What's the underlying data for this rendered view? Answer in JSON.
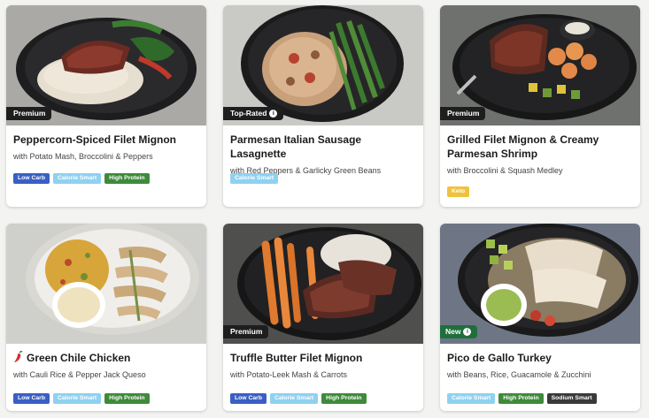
{
  "meals": [
    {
      "badge": "Premium",
      "badge_style": "dark",
      "badge_info": false,
      "title": "Peppercorn-Spiced Filet Mignon",
      "subtitle": "with Potato Mash, Broccolini & Peppers",
      "spicy": false,
      "tags": [
        {
          "label": "Low Carb",
          "color": "#3a5fc4"
        },
        {
          "label": "Calorie Smart",
          "color": "#8fd1f0"
        },
        {
          "label": "High Protein",
          "color": "#3f8a3a"
        }
      ]
    },
    {
      "badge": "Top-Rated",
      "badge_style": "dark",
      "badge_info": true,
      "title": "Parmesan Italian Sausage Lasagnette",
      "subtitle": "with Red Peppers & Garlicky Green Beans",
      "spicy": false,
      "tags": [
        {
          "label": "Calorie Smart",
          "color": "#8fd1f0"
        }
      ]
    },
    {
      "badge": "Premium",
      "badge_style": "dark",
      "badge_info": false,
      "title": "Grilled Filet Mignon & Creamy Parmesan Shrimp",
      "subtitle": "with Broccolini & Squash Medley",
      "spicy": false,
      "tags": [
        {
          "label": "Keto",
          "color": "#f0c23b"
        }
      ]
    },
    {
      "badge": "",
      "badge_style": "none",
      "badge_info": false,
      "title": "Green Chile Chicken",
      "subtitle": "with Cauli Rice & Pepper Jack Queso",
      "spicy": true,
      "tags": [
        {
          "label": "Low Carb",
          "color": "#3a5fc4"
        },
        {
          "label": "Calorie Smart",
          "color": "#8fd1f0"
        },
        {
          "label": "High Protein",
          "color": "#3f8a3a"
        }
      ]
    },
    {
      "badge": "Premium",
      "badge_style": "dark",
      "badge_info": false,
      "title": "Truffle Butter Filet Mignon",
      "subtitle": "with Potato-Leek Mash & Carrots",
      "spicy": false,
      "tags": [
        {
          "label": "Low Carb",
          "color": "#3a5fc4"
        },
        {
          "label": "Calorie Smart",
          "color": "#8fd1f0"
        },
        {
          "label": "High Protein",
          "color": "#3f8a3a"
        }
      ]
    },
    {
      "badge": "New",
      "badge_style": "green",
      "badge_info": true,
      "title": "Pico de Gallo Turkey",
      "subtitle": "with Beans, Rice, Guacamole & Zucchini",
      "spicy": false,
      "tags": [
        {
          "label": "Calorie Smart",
          "color": "#8fd1f0"
        },
        {
          "label": "High Protein",
          "color": "#3f8a3a"
        },
        {
          "label": "Sodium Smart",
          "color": "#3a3a3a"
        }
      ]
    }
  ]
}
